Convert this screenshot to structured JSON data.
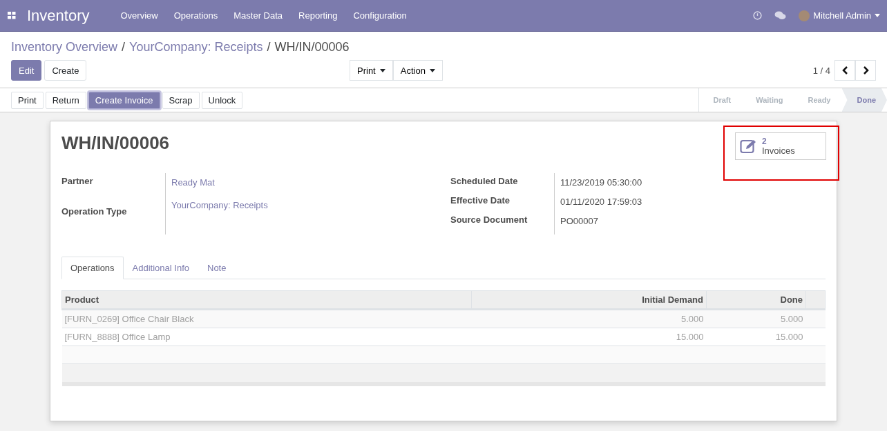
{
  "navbar": {
    "app": "Inventory",
    "menu": [
      "Overview",
      "Operations",
      "Master Data",
      "Reporting",
      "Configuration"
    ],
    "user": "Mitchell Admin"
  },
  "breadcrumbs": [
    {
      "label": "Inventory Overview"
    },
    {
      "separator": "/",
      "label": "YourCompany: Receipts"
    },
    {
      "separator": "/",
      "label": "WH/IN/00006"
    }
  ],
  "main_buttons": [
    {
      "label": "Edit",
      "primary": true
    },
    {
      "label": "Create",
      "primary": false
    }
  ],
  "dropdowns": [
    "Print",
    "Action"
  ],
  "pager": "1 / 4",
  "header_buttons": [
    {
      "label": "Print",
      "primary": false
    },
    {
      "label": "Return",
      "primary": false
    },
    {
      "label": "Create Invoice",
      "primary": true
    },
    {
      "label": "Scrap",
      "primary": false
    },
    {
      "label": "Unlock",
      "primary": false
    }
  ],
  "stages": [
    {
      "label": "Draft",
      "selected": false
    },
    {
      "label": "Waiting",
      "selected": false
    },
    {
      "label": "Ready",
      "selected": false
    },
    {
      "label": "Done",
      "selected": true
    }
  ],
  "sheet": {
    "title": "WH/IN/00006",
    "smart_button": {
      "count": "2",
      "label": "Invoices",
      "highlighted": true
    },
    "left_fields": [
      {
        "label": "Partner",
        "value": "Ready Mat",
        "link": true
      },
      {
        "label": "Operation Type",
        "value": "YourCompany: Receipts",
        "link": true
      }
    ],
    "right_fields": [
      {
        "label": "Scheduled Date",
        "value": "11/23/2019 05:30:00",
        "link": false
      },
      {
        "label": "Effective Date",
        "value": "01/11/2020 17:59:03",
        "link": false
      },
      {
        "label": "Source Document",
        "value": "PO00007",
        "link": false
      }
    ],
    "tabs": [
      {
        "label": "Operations",
        "selected": true
      },
      {
        "label": "Additional Info",
        "selected": false
      },
      {
        "label": "Note",
        "selected": false
      }
    ],
    "table": {
      "columns": [
        "Product",
        "Initial Demand",
        "Done"
      ],
      "rows": [
        [
          "[FURN_0269] Office Chair Black",
          "5.000",
          "5.000"
        ],
        [
          "[FURN_8888] Office Lamp",
          "15.000",
          "15.000"
        ]
      ]
    }
  }
}
